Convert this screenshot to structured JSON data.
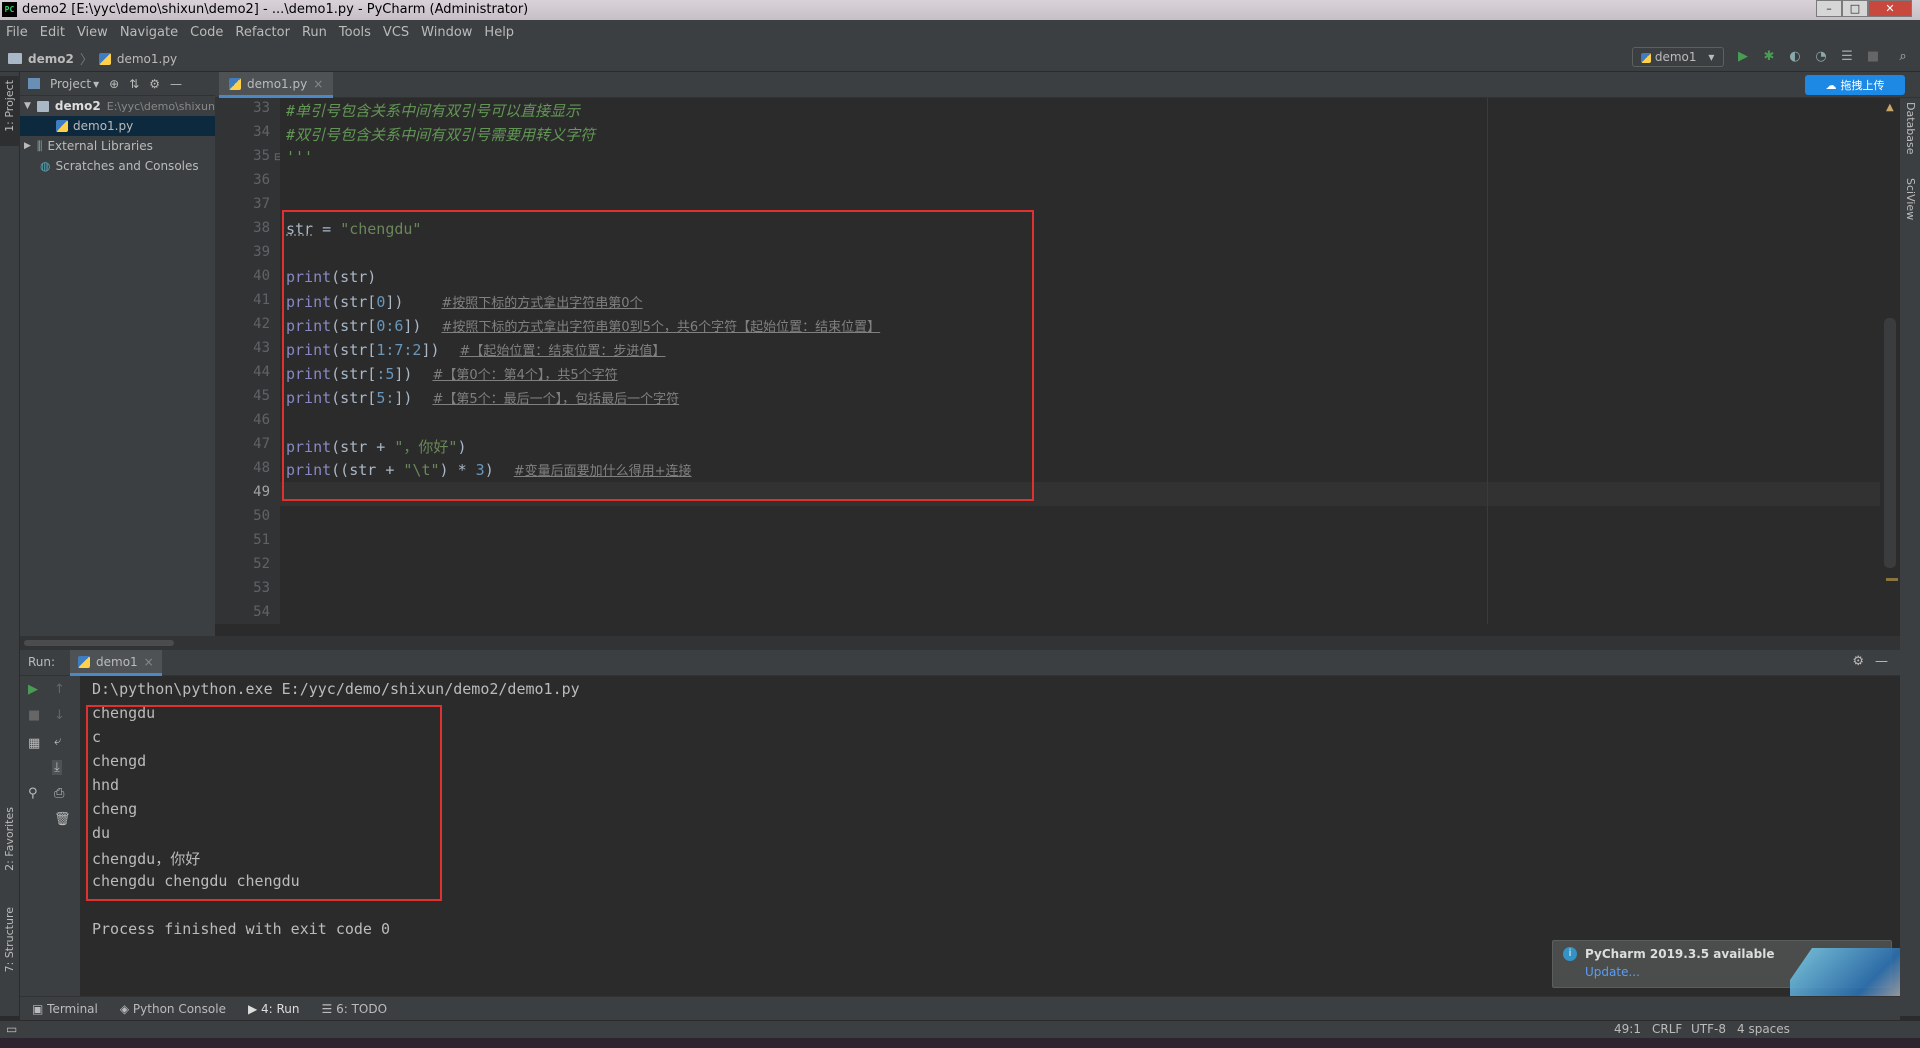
{
  "window": {
    "app_icon": "PC",
    "title": "demo2 [E:\\yyc\\demo\\shixun\\demo2] - ...\\demo1.py - PyCharm (Administrator)",
    "buttons": [
      "–",
      "□",
      "✕"
    ]
  },
  "menu": [
    "File",
    "Edit",
    "View",
    "Navigate",
    "Code",
    "Refactor",
    "Run",
    "Tools",
    "VCS",
    "Window",
    "Help"
  ],
  "breadcrumb": {
    "project": "demo2",
    "file": "demo1.py"
  },
  "run_config": {
    "label": "demo1",
    "dropdown_icon": "▾"
  },
  "toolbar_icons": [
    "run-icon",
    "debug-icon",
    "coverage-icon",
    "profile-icon",
    "concurrency-icon",
    "stop-icon",
    "search-icon"
  ],
  "project_panel": {
    "header_label": "Project",
    "tree": [
      {
        "label": "demo2",
        "path": "E:\\yyc\\demo\\shixun",
        "type": "folder"
      },
      {
        "label": "demo1.py",
        "type": "file",
        "selected": true
      },
      {
        "label": "External Libraries",
        "type": "library"
      },
      {
        "label": "Scratches and Consoles",
        "type": "scratch"
      }
    ]
  },
  "left_stripe": {
    "project": "1: Project",
    "favorites": "2: Favorites",
    "structure": "7: Structure"
  },
  "right_stripe": {
    "database": "Database",
    "sciview": "SciView"
  },
  "editor": {
    "tab": "demo1.py",
    "tab_close": "×",
    "baidu_button": "拖拽上传",
    "line_numbers": [
      "33",
      "34",
      "35",
      "36",
      "37",
      "38",
      "39",
      "40",
      "41",
      "42",
      "43",
      "44",
      "45",
      "46",
      "47",
      "48",
      "49",
      "50",
      "51",
      "52",
      "53",
      "54"
    ],
    "comment33": "#单引号包含关系中间有双引号可以直接显示",
    "comment34": "#双引号包含关系中间有双引号需要用转义字符",
    "line35": "'''",
    "line38": {
      "var": "str",
      "op": " = ",
      "value": "\"chengdu\""
    },
    "line40": {
      "fn": "print",
      "rest": "(str)"
    },
    "line41": {
      "fn": "print",
      "a": "(str[",
      "n": "0",
      "b": "])",
      "comment": "#按照下标的方式拿出字符串第0个"
    },
    "line42": {
      "fn": "print",
      "a": "(str[",
      "n": "0:6",
      "b": "])",
      "comment": "#按照下标的方式拿出字符串第0到5个，共6个字符【起始位置：结束位置】"
    },
    "line43": {
      "fn": "print",
      "a": "(str[",
      "n": "1:7:2",
      "b": "])",
      "comment": "#【起始位置：结束位置：步进值】"
    },
    "line44": {
      "fn": "print",
      "a": "(str[",
      "n": ":5",
      "b": "])",
      "comment": "#【第0个：第4个】，共5个字符"
    },
    "line45": {
      "fn": "print",
      "a": "(str[",
      "n": "5:",
      "b": "])",
      "comment": "#【第5个：最后一个】，包括最后一个字符"
    },
    "line47": {
      "fn": "print",
      "a": "(str + ",
      "s": "\"，你好\"",
      "b": ")"
    },
    "line48": {
      "fn": "print",
      "a": "((str + ",
      "s": "\"\\t\"",
      "b": ") * ",
      "n": "3",
      "c": ")",
      "comment": "#变量后面要加什么得用+连接"
    }
  },
  "run_panel": {
    "label": "Run:",
    "tab": "demo1",
    "command": "D:\\python\\python.exe E:/yyc/demo/shixun/demo2/demo1.py",
    "output": [
      "chengdu",
      "c",
      "chengd",
      "hnd",
      "cheng",
      "du",
      "chengdu，你好",
      "chengdu\tchengdu\tchengdu"
    ],
    "exit": "Process finished with exit code 0"
  },
  "bottom_tools": [
    "Terminal",
    "Python Console",
    "4: Run",
    "6: TODO"
  ],
  "notification": {
    "title": "PyCharm 2019.3.5 available",
    "link": "Update..."
  },
  "status": {
    "position": "49:1",
    "line_sep": "CRLF",
    "encoding": "UTF-8",
    "indent": "4 spaces"
  },
  "colors": {
    "accent": "#4a88c7",
    "highlight_box": "#e03131",
    "run_green": "#499c54"
  }
}
